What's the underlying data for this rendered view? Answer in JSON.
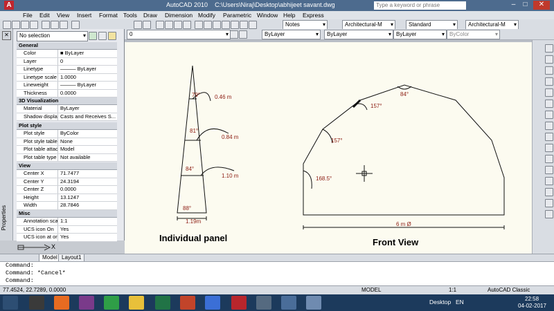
{
  "titlebar": {
    "app_name": "AutoCAD 2010",
    "path": "C:\\Users\\Niraj\\Desktop\\abhijeet savant.dwg",
    "search_placeholder": "Type a keyword or phrase"
  },
  "menu": [
    "File",
    "Edit",
    "View",
    "Insert",
    "Format",
    "Tools",
    "Draw",
    "Dimension",
    "Modify",
    "Parametric",
    "Window",
    "Help",
    "Express"
  ],
  "toolbar": {
    "annotation": "Notes",
    "annotation_style": "Architectural-M",
    "text_style": "Standard",
    "dim_style": "Architectural-M",
    "layer": "0",
    "color": "ByLayer",
    "linetype": "ByLayer",
    "lineweight": "ByLayer",
    "plotstyle": "ByColor"
  },
  "properties": {
    "selection": "No selection",
    "palette_label": "Properties",
    "sections": [
      {
        "title": "General",
        "rows": [
          [
            "Color",
            "■ ByLayer"
          ],
          [
            "Layer",
            "0"
          ],
          [
            "Linetype",
            "——— ByLayer"
          ],
          [
            "Linetype scale",
            "1.0000"
          ],
          [
            "Lineweight",
            "——— ByLayer"
          ],
          [
            "Thickness",
            "0.0000"
          ]
        ]
      },
      {
        "title": "3D Visualization",
        "rows": [
          [
            "Material",
            "ByLayer"
          ],
          [
            "Shadow display",
            "Casts and Receives S..."
          ]
        ]
      },
      {
        "title": "Plot style",
        "rows": [
          [
            "Plot style",
            "ByColor"
          ],
          [
            "Plot style table",
            "None"
          ],
          [
            "Plot table attach...",
            "Model"
          ],
          [
            "Plot table type",
            "Not available"
          ]
        ]
      },
      {
        "title": "View",
        "rows": [
          [
            "Center X",
            "71.7477"
          ],
          [
            "Center Y",
            "24.3194"
          ],
          [
            "Center Z",
            "0.0000"
          ],
          [
            "Height",
            "13.1247"
          ],
          [
            "Width",
            "28.7846"
          ]
        ]
      },
      {
        "title": "Misc",
        "rows": [
          [
            "Annotation scale",
            "1:1"
          ],
          [
            "UCS icon On",
            "Yes"
          ],
          [
            "UCS icon at origin",
            "Yes"
          ]
        ]
      }
    ]
  },
  "drawing": {
    "panel_title": "Individual panel",
    "front_title": "Front  View",
    "panel_angles": [
      "79°",
      "81°",
      "84°",
      "88°"
    ],
    "panel_heights": [
      "0.46 m",
      "0.84 m",
      "1.10 m"
    ],
    "panel_width": "1.19m",
    "front_angles": [
      "84°",
      "157°",
      "157°",
      "168.5°"
    ],
    "front_width": "6 m  Ø",
    "ucs_x": "X"
  },
  "tabs": [
    "Model",
    "Layout1"
  ],
  "command_lines": [
    "Command:",
    "Command: *Cancel*",
    "Command:"
  ],
  "status": {
    "coords": "77.4524, 22.7289, 0.0000",
    "model": "MODEL",
    "scale": "1:1",
    "workspace": "AutoCAD Classic"
  },
  "taskbar": {
    "desktop": "Desktop",
    "lang": "EN",
    "time": "22:58",
    "date": "04-02-2017"
  },
  "colors": {
    "title_bg": "#4d6b8e",
    "drawing_bg": "#fcfbf0",
    "dim_text": "#8b1a10"
  }
}
